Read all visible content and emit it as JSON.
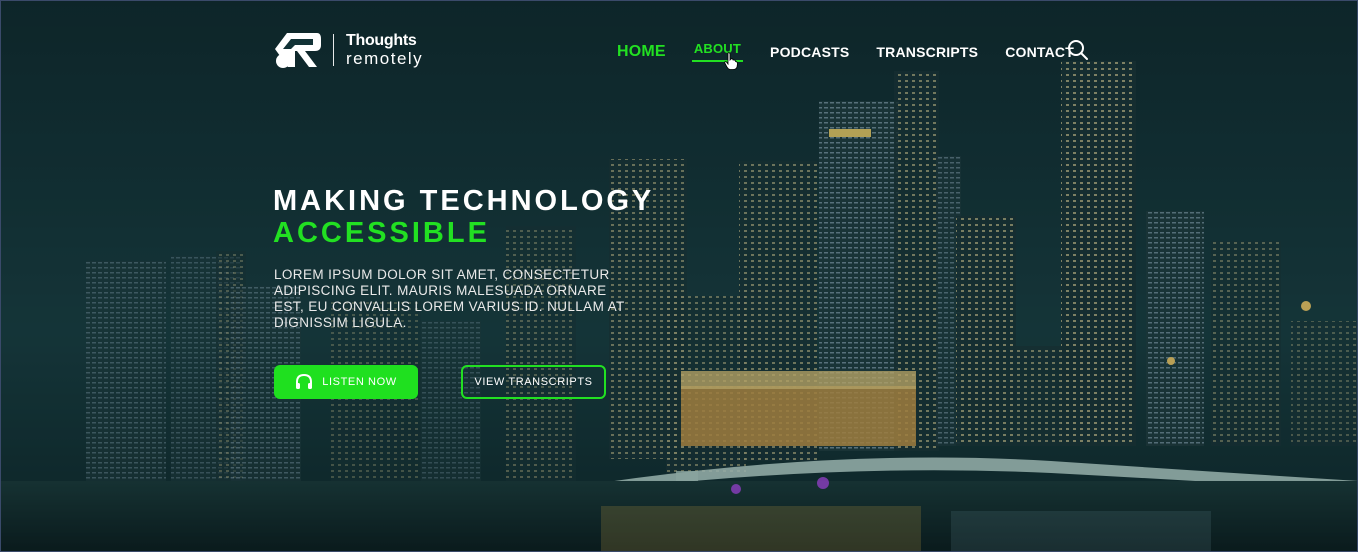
{
  "brand": {
    "line1": "Thoughts",
    "line2": "remotely"
  },
  "nav": {
    "items": [
      {
        "label": "HOME"
      },
      {
        "label": "ABOUT"
      },
      {
        "label": "PODCASTS"
      },
      {
        "label": "TRANSCRIPTS"
      },
      {
        "label": "CONTACT"
      }
    ],
    "search_icon": "search-icon"
  },
  "hero": {
    "title_line1": "MAKING TECHNOLOGY",
    "title_line2": "ACCESSIBLE",
    "description": "LOREM IPSUM DOLOR SIT AMET, CONSECTETUR ADIPISCING ELIT. MAURIS MALESUADA ORNARE EST, EU CONVALLIS LOREM VARIUS ID. NULLAM AT DIGNISSIM LIGULA.",
    "listen_label": "LISTEN NOW",
    "listen_icon": "headphones-icon",
    "view_label": "VIEW TRANSCRIPTS"
  },
  "colors": {
    "accent": "#22e022",
    "text": "#ffffff",
    "background": "#123236"
  }
}
